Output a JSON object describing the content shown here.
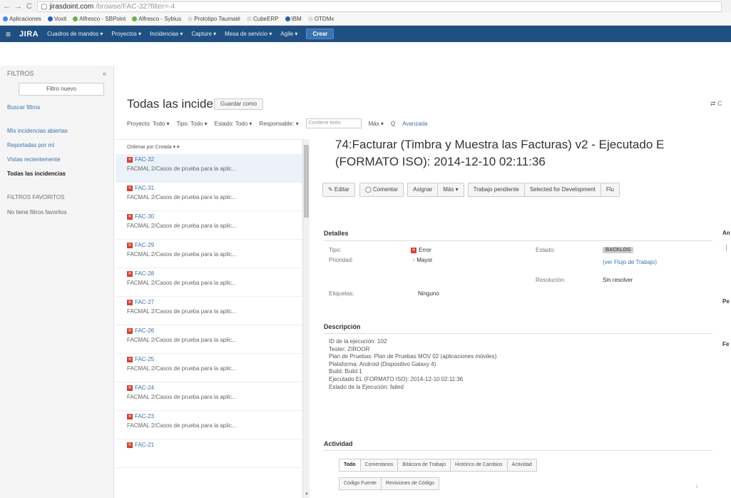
{
  "browser": {
    "url_host": "jirasdoint.com",
    "url_path": "/browse/FAC-32?filter=-4",
    "bookmarks": [
      "Aplicaciones",
      "Voxit",
      "Alfresco - SBPoint",
      "Alfresco - Sybius",
      "Prototipo Taumaté",
      "CubeERP",
      "IBM",
      "OTDMx"
    ]
  },
  "jira": {
    "logo": "JIRA",
    "nav": [
      "Cuadros de mandos ▾",
      "Proyectos ▾",
      "Incidencias ▾",
      "Capture ▾",
      "Mesa de servicio ▾",
      "Agile ▾"
    ],
    "create_label": "Crear"
  },
  "sidebar": {
    "header": "FILTROS",
    "collapse": "«",
    "new_filter": "Filtro nuevo",
    "find_filters": "Buscar filtros",
    "items": [
      "Mis incidencias abiertas",
      "Reportadas por mí",
      "Vistas recientemente",
      "Todas las incidencias"
    ],
    "favorites_header": "FILTROS FAVORITOS",
    "favorites_note": "No tiene filtros favoritos"
  },
  "page": {
    "title": "Todas las incidencias",
    "save_as": "Guardar como",
    "share": "⇄ C"
  },
  "filters": [
    "Proyecto: Todo ▾",
    "Tipo: Todo ▾",
    "Estado: Todo ▾",
    "Responsable: ▾"
  ],
  "filter_contains_placeholder": "Contiene texto",
  "filter_more": "Más ▾",
  "filter_search": "Q",
  "filter_advanced": "Avanzada",
  "list": {
    "order_by": "Ordenar por Creada ▾ ▾",
    "issues": [
      {
        "key": "FAC-32",
        "summary": "FACMAL 2/Casos de prueba para la aplic..."
      },
      {
        "key": "FAC-31",
        "summary": "FACMAL 2/Casos de prueba para la aplic..."
      },
      {
        "key": "FAC-30",
        "summary": "FACMAL 2/Casos de prueba para la aplic..."
      },
      {
        "key": "FAC-29",
        "summary": "FACMAL 2/Casos de prueba para la aplic..."
      },
      {
        "key": "FAC-28",
        "summary": "FACMAL 2/Casos de prueba para la aplic..."
      },
      {
        "key": "FAC-27",
        "summary": "FACMAL 2/Casos de prueba para la aplic..."
      },
      {
        "key": "FAC-26",
        "summary": "FACMAL 2/Casos de prueba para la aplic..."
      },
      {
        "key": "FAC-25",
        "summary": "FACMAL 2/Casos de prueba para la aplic..."
      },
      {
        "key": "FAC-24",
        "summary": "FACMAL 2/Casos de prueba para la aplic..."
      },
      {
        "key": "FAC-23",
        "summary": "FACMAL 2/Casos de prueba para la aplic..."
      },
      {
        "key": "FAC-21",
        "summary": ""
      }
    ]
  },
  "detail": {
    "title_line1": "74:Facturar (Timbra y Muestra las Facturas) v2 - Ejecutado E",
    "title_line2": "(FORMATO ISO): 2014-12-10 02:11:36",
    "actions": [
      "✎ Editar",
      "◯ Comentar",
      "Asignar",
      "Más ▾",
      "Trabajo pendiente",
      "Selected for Development",
      "Flu"
    ],
    "details_header": "Detalles",
    "type_label": "Tipo:",
    "type_value": "Error",
    "priority_label": "Prioridad:",
    "priority_value": "Mayor",
    "labels_label": "Etiquetas:",
    "labels_value": "Ninguno",
    "status_label": "Estado:",
    "status_value": "BACKLOG",
    "status_link": "(ver Flujo de Trabajo)",
    "resolution_label": "Resolución:",
    "resolution_value": "Sin resolver",
    "description_header": "Descripción",
    "description_lines": [
      "ID de la ejecución: 102",
      "Tester: ZIROOR",
      "Plan de Pruebas: Plan de Pruebas MOV 02 (aplicaciones móviles)",
      "Plataforma: Android (Dispositivo Galaxy 4)",
      "Build: Build 1",
      "Ejecutado EL (FORMATO ISO): 2014-12-10 02:11:36",
      "Estado de la Ejecución: failed"
    ],
    "activity_header": "Actividad",
    "activity_tabs": [
      "Todo",
      "Comentarios",
      "Bitácora de Trabajo",
      "Histórico de Cambios",
      "Actividad"
    ],
    "activity_tabs2": [
      "Código Fuente",
      "Revisiones de Código"
    ],
    "right_col": [
      "An",
      "Pe",
      "Fe"
    ]
  }
}
